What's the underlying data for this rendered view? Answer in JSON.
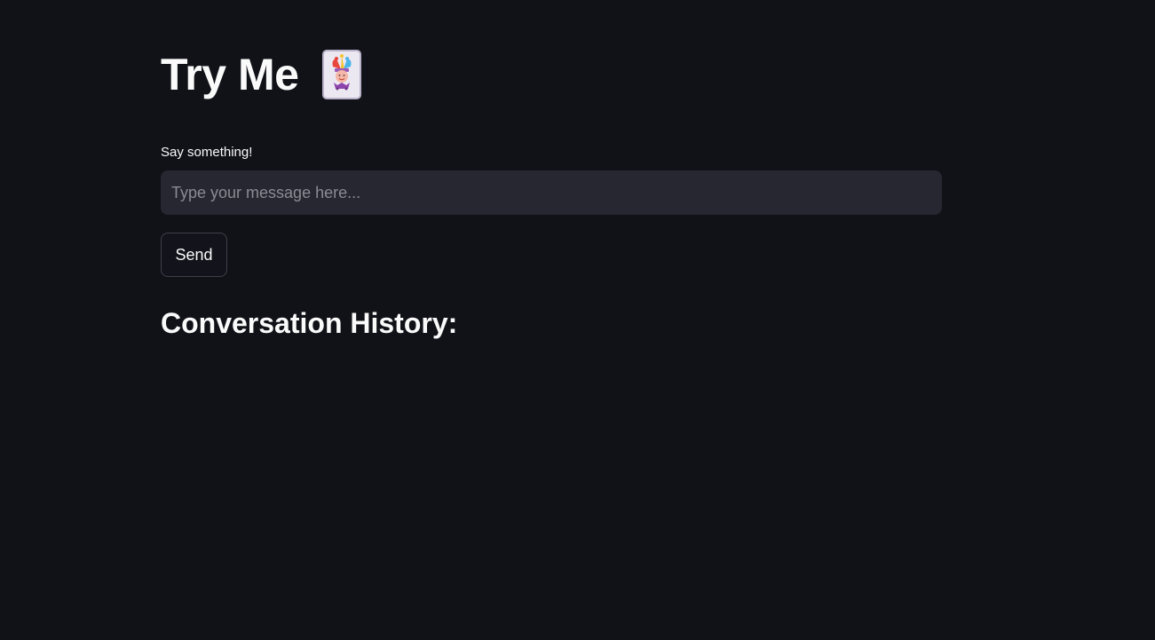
{
  "page": {
    "title": "Try Me",
    "title_icon": "jester-card-icon"
  },
  "form": {
    "label": "Say something!",
    "input_value": "",
    "input_placeholder": "Type your message here...",
    "send_label": "Send"
  },
  "history": {
    "heading": "Conversation History:",
    "messages": []
  },
  "colors": {
    "background": "#111218",
    "input_background": "#262730",
    "text": "#fafafa",
    "placeholder": "#8a8b93",
    "button_border": "#3e3f48"
  }
}
